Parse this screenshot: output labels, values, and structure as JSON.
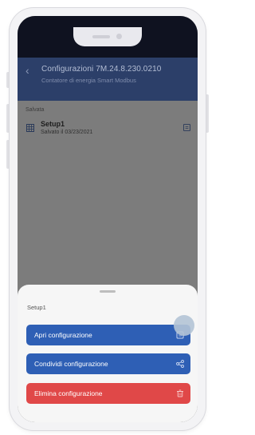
{
  "header": {
    "title": "Configurazioni 7M.24.8.230.0210",
    "subtitle": "Contatore di energia Smart Modbus"
  },
  "content": {
    "section_label": "Salvata",
    "item": {
      "title": "Setup1",
      "subtitle": "Salvato il 03/23/2021"
    }
  },
  "sheet": {
    "title": "Setup1",
    "actions": [
      {
        "label": "Apri configurazione",
        "icon": "copy-icon"
      },
      {
        "label": "Condividi configurazione",
        "icon": "share-icon"
      },
      {
        "label": "Elimina configurazione",
        "icon": "trash-icon"
      }
    ]
  },
  "colors": {
    "primary": "#2e5fb5",
    "danger": "#e04848",
    "header": "#2c3f69"
  }
}
